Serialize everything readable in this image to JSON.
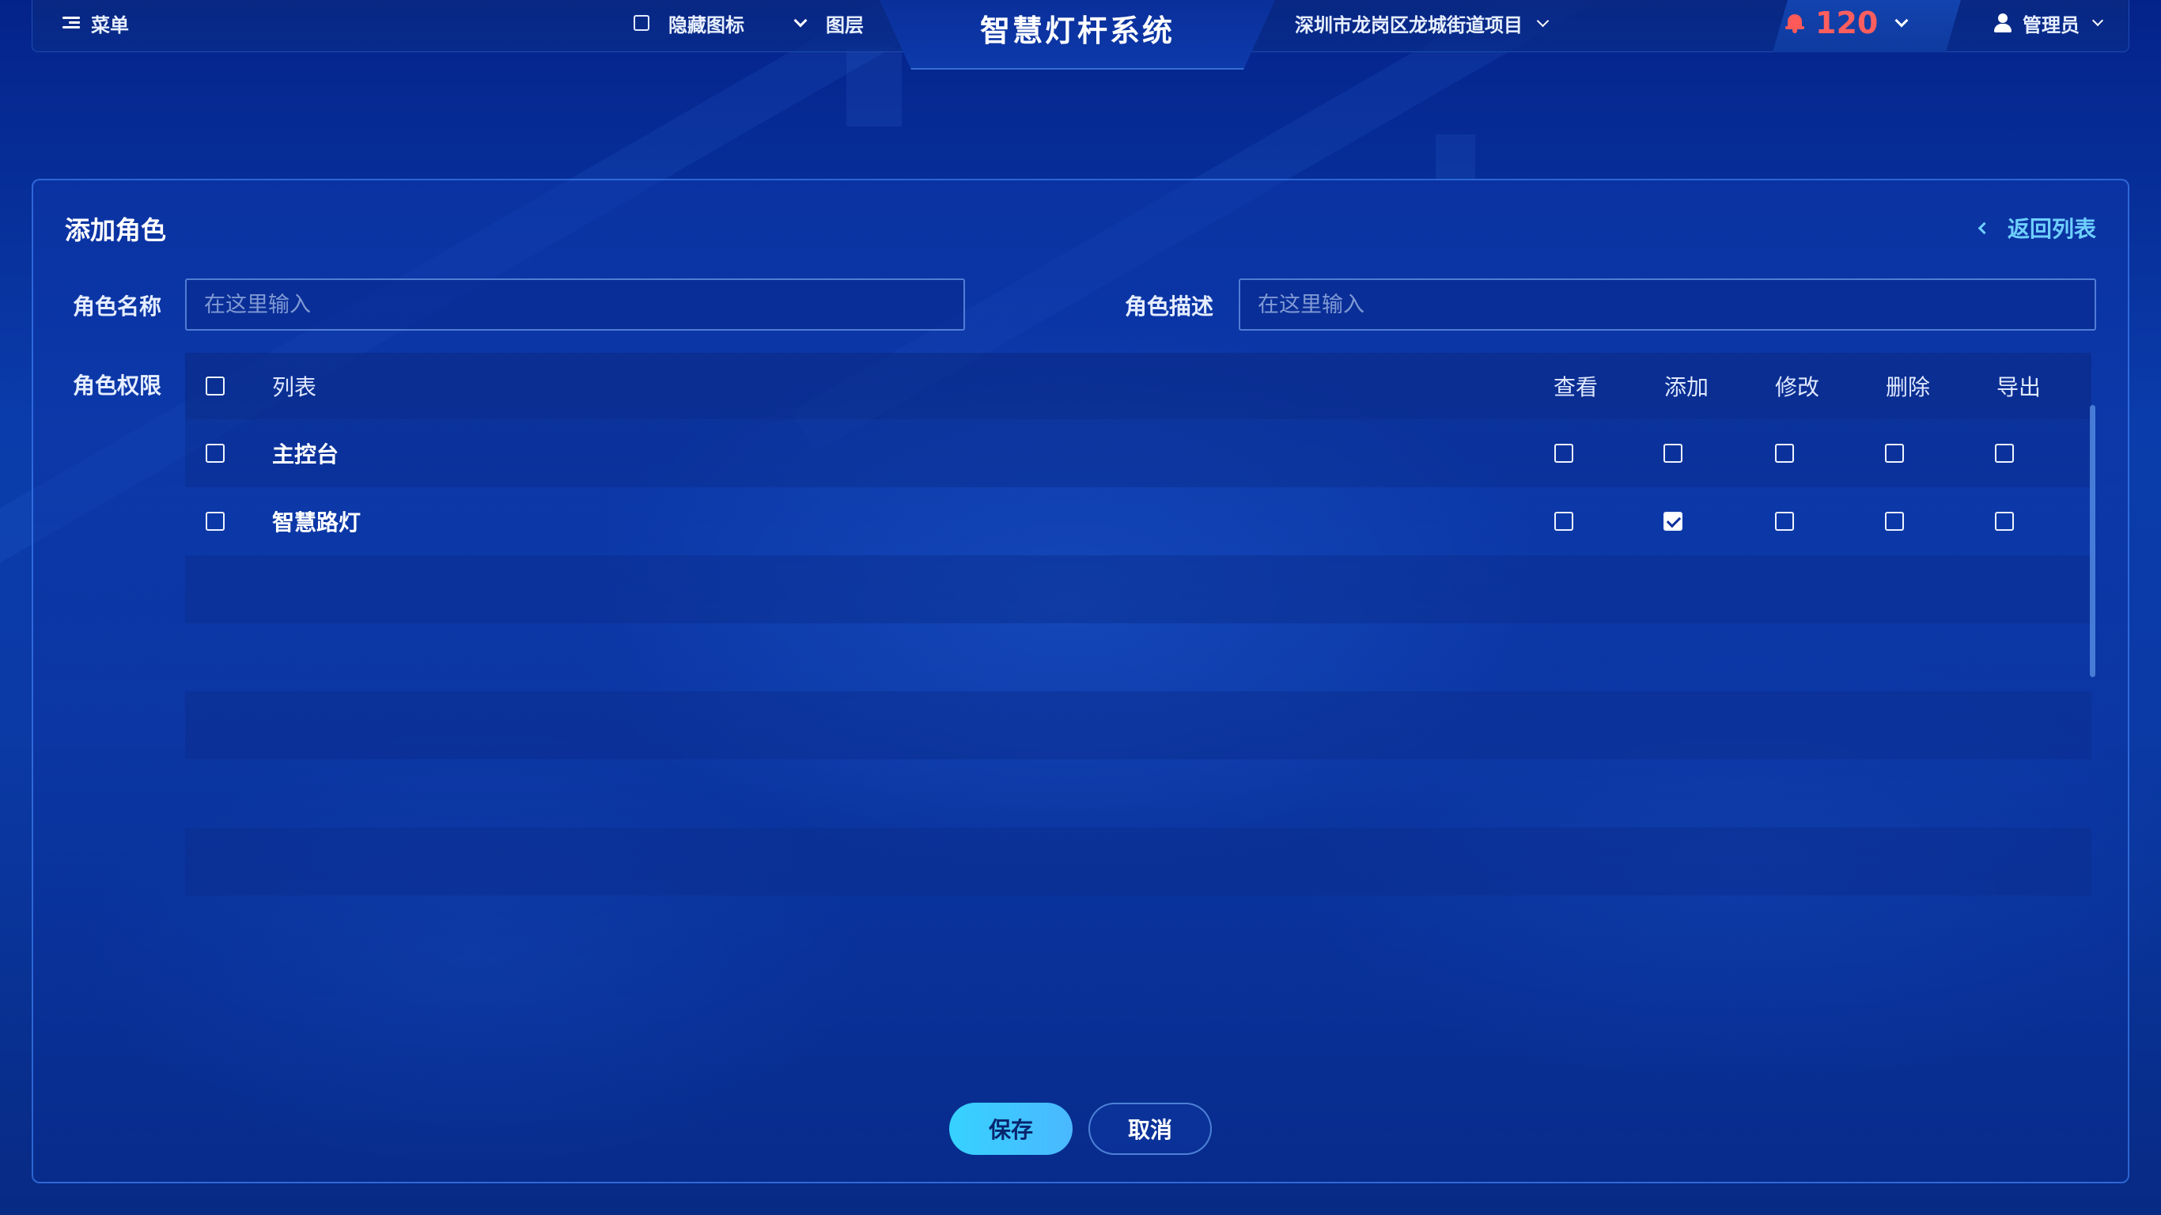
{
  "header": {
    "menu_label": "菜单",
    "hide_icons_label": "隐藏图标",
    "layers_label": "图层",
    "system_title": "智慧灯杆系统",
    "project_name": "深圳市龙岗区龙城街道项目",
    "alert_count": "120",
    "user_name": "管理员"
  },
  "panel": {
    "title": "添加角色",
    "back_label": "返回列表"
  },
  "form": {
    "role_name_label": "角色名称",
    "role_name_placeholder": "在这里输入",
    "role_desc_label": "角色描述",
    "role_desc_placeholder": "在这里输入",
    "permissions_label": "角色权限"
  },
  "table": {
    "headers": {
      "list": "列表",
      "view": "查看",
      "add": "添加",
      "edit": "修改",
      "delete": "删除",
      "export": "导出"
    },
    "rows": [
      {
        "name": "主控台",
        "selected": false,
        "view": false,
        "add": false,
        "edit": false,
        "delete": false,
        "export": false
      },
      {
        "name": "智慧路灯",
        "selected": false,
        "view": false,
        "add": true,
        "edit": false,
        "delete": false,
        "export": false
      }
    ]
  },
  "actions": {
    "save_label": "保存",
    "cancel_label": "取消"
  },
  "colors": {
    "accent": "#36d2ff",
    "alert": "#ff5e5e",
    "link": "#6fd0ff",
    "background": "#0a3cab"
  },
  "icons": [
    "menu-icon",
    "checkbox-icon",
    "chevron-down-icon",
    "bell-icon",
    "user-icon",
    "chevron-left-icon"
  ]
}
